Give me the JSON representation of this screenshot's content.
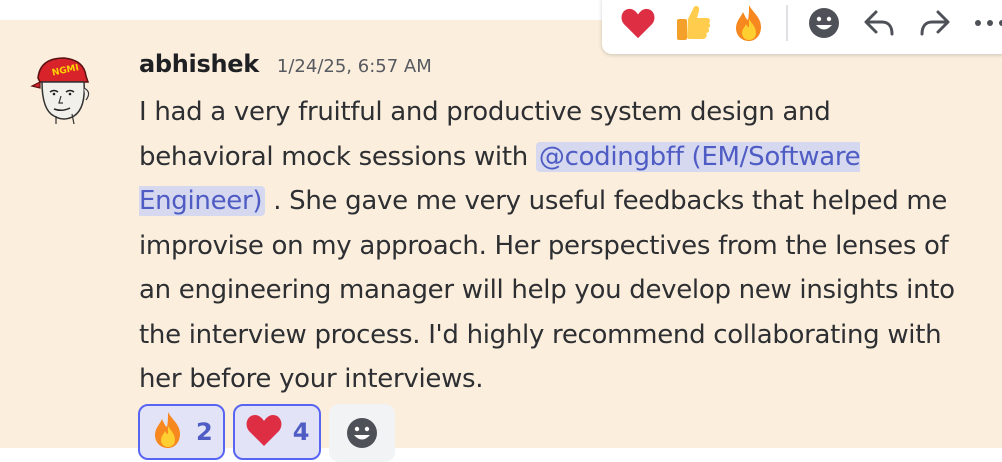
{
  "message": {
    "author": "abhishek",
    "timestamp": "1/24/25, 6:57 AM",
    "text_before_mention": "I had a very fruitful and productive system design and behavioral mock sessions with ",
    "mention": "@codingbff (EM/Software Engineer)",
    "text_after_mention": " . She gave me very useful feedbacks that helped me improvise on my approach. Her perspectives from the lenses of an engineering manager will help you develop new insights into the interview process. I'd highly recommend collaborating with her before your interviews.",
    "avatar": {
      "icon": "meme-avatar-icon",
      "cap_text": "NGMI"
    },
    "reactions": [
      {
        "emoji": "🔥",
        "icon": "fire-icon",
        "count": "2"
      },
      {
        "emoji": "❤️",
        "icon": "heart-icon",
        "count": "4"
      }
    ]
  },
  "toolbar": {
    "quick_reactions": [
      {
        "emoji": "❤️",
        "icon": "heart-icon"
      },
      {
        "emoji": "👍",
        "icon": "thumbs-up-icon"
      },
      {
        "emoji": "🔥",
        "icon": "fire-icon"
      }
    ],
    "actions": [
      "add-reaction-icon",
      "reply-icon",
      "forward-icon",
      "more-icon"
    ]
  },
  "colors": {
    "highlight_bg": "#fbeedc",
    "mention_bg": "#d5d8ef",
    "mention_text": "#4e5cc4",
    "reaction_border": "#5865f2"
  }
}
